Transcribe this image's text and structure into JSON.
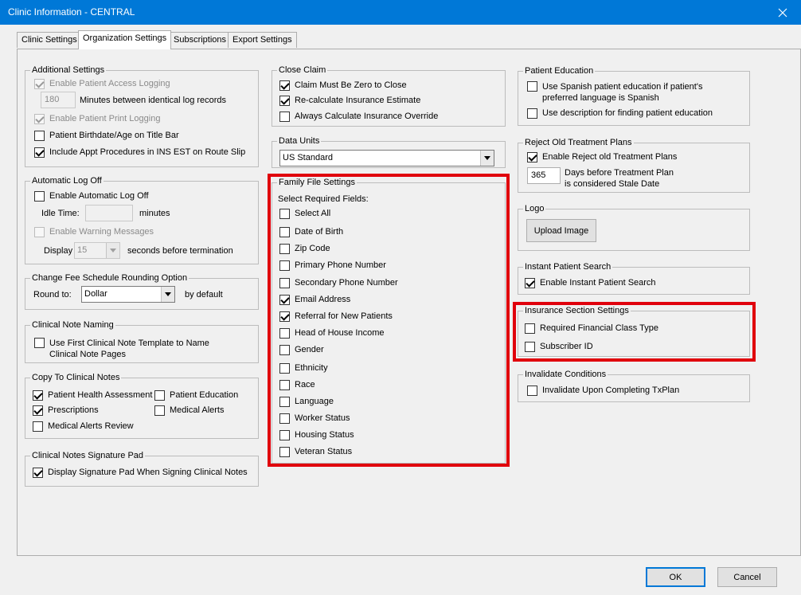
{
  "window": {
    "title": "Clinic Information - CENTRAL",
    "close_glyph": "✕"
  },
  "tabs": [
    "Clinic Settings",
    "Organization Settings",
    "Subscriptions",
    "Export Settings"
  ],
  "additional_settings": {
    "legend": "Additional Settings",
    "enable_access_logging": "Enable Patient Access Logging",
    "minutes_value": "180",
    "minutes_label": "Minutes between identical log records",
    "enable_print_logging": "Enable Patient Print Logging",
    "birthdate_title": "Patient Birthdate/Age on Title Bar",
    "include_appt": "Include Appt Procedures in INS EST on Route Slip"
  },
  "auto_logoff": {
    "legend": "Automatic Log Off",
    "enable": "Enable Automatic Log Off",
    "idle_time": "Idle Time:",
    "minutes": "minutes",
    "warning": "Enable Warning Messages",
    "display": "Display",
    "display_value": "15",
    "seconds": "seconds before termination"
  },
  "fee_rounding": {
    "legend": "Change Fee Schedule Rounding Option",
    "round_to": "Round to:",
    "value": "Dollar",
    "by_default": "by default"
  },
  "clinical_note_naming": {
    "legend": "Clinical Note Naming",
    "option_line1": "Use First Clinical Note Template to Name",
    "option_line2": "Clinical Note Pages"
  },
  "copy_to_notes": {
    "legend": "Copy To Clinical Notes",
    "health_assessment": "Patient Health Assessment",
    "patient_education": "Patient Education",
    "prescriptions": "Prescriptions",
    "medical_alerts": "Medical Alerts",
    "medical_alerts_review": "Medical Alerts Review"
  },
  "signature_pad": {
    "legend": "Clinical Notes Signature Pad",
    "display": "Display Signature Pad When Signing Clinical Notes"
  },
  "close_claim": {
    "legend": "Close Claim",
    "zero": "Claim Must Be Zero to Close",
    "recalc": "Re-calculate Insurance Estimate",
    "always": "Always Calculate Insurance Override"
  },
  "data_units": {
    "legend": "Data Units",
    "value": "US Standard"
  },
  "family_file": {
    "legend": "Family File Settings",
    "subheading": "Select Required Fields:",
    "fields": [
      "Select All",
      "Date of Birth",
      "Zip Code",
      "Primary Phone Number",
      "Secondary Phone Number",
      "Email Address",
      "Referral for New Patients",
      "Head of House Income",
      "Gender",
      "Ethnicity",
      "Race",
      "Language",
      "Worker Status",
      "Housing Status",
      "Veteran Status"
    ]
  },
  "patient_education": {
    "legend": "Patient Education",
    "spanish_line1": "Use Spanish patient education if patient's",
    "spanish_line2": "preferred language is Spanish",
    "description": "Use description for finding patient education"
  },
  "reject_plans": {
    "legend": "Reject Old Treatment Plans",
    "enable": "Enable Reject old Treatment Plans",
    "days_value": "365",
    "days_line1": "Days before Treatment Plan",
    "days_line2": "is considered Stale Date"
  },
  "logo": {
    "legend": "Logo",
    "upload": "Upload Image"
  },
  "instant_search": {
    "legend": "Instant Patient Search",
    "enable": "Enable Instant Patient Search"
  },
  "insurance_section": {
    "legend": "Insurance Section Settings",
    "financial_class": "Required Financial Class Type",
    "subscriber_id": "Subscriber ID"
  },
  "invalidate": {
    "legend": "Invalidate Conditions",
    "option": "Invalidate Upon Completing TxPlan"
  },
  "footer": {
    "ok": "OK",
    "cancel": "Cancel"
  },
  "colors": {
    "titlebar": "#0078d7",
    "highlight": "#e0000c",
    "background": "#f0f0f0"
  }
}
